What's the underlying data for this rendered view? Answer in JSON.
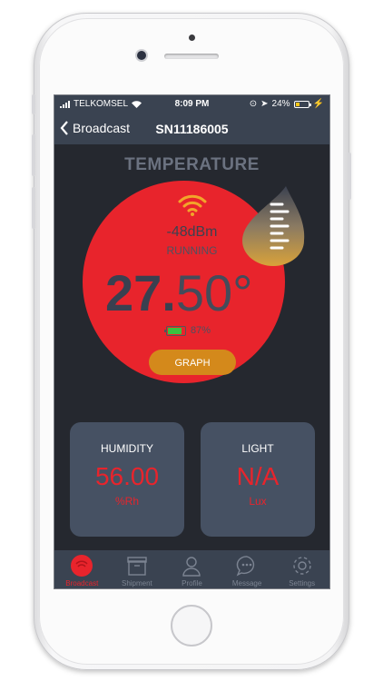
{
  "statusbar": {
    "carrier": "TELKOMSEL",
    "time": "8:09 PM",
    "battery": "24%"
  },
  "nav": {
    "back_label": "Broadcast",
    "title": "SN11186005"
  },
  "sensor": {
    "title": "TEMPERATURE",
    "rssi": "-48dBm",
    "state": "RUNNING",
    "reading_int": "27.",
    "reading_frac": "50°",
    "battery": "87%",
    "battery_level": 0.87,
    "graph_label": "GRAPH"
  },
  "cards": [
    {
      "label": "HUMIDITY",
      "value": "56.00",
      "unit": "%Rh"
    },
    {
      "label": "LIGHT",
      "value": "N/A",
      "unit": "Lux"
    }
  ],
  "tabs": [
    {
      "label": "Broadcast",
      "icon": "broadcast-icon",
      "active": true
    },
    {
      "label": "Shipment",
      "icon": "box-icon"
    },
    {
      "label": "Profile",
      "icon": "person-icon"
    },
    {
      "label": "Message",
      "icon": "chat-icon"
    },
    {
      "label": "Settings",
      "icon": "gear-icon"
    }
  ],
  "colors": {
    "accent": "#e8242c",
    "button": "#d4891b",
    "bar": "#3a4351",
    "card": "#465163"
  }
}
